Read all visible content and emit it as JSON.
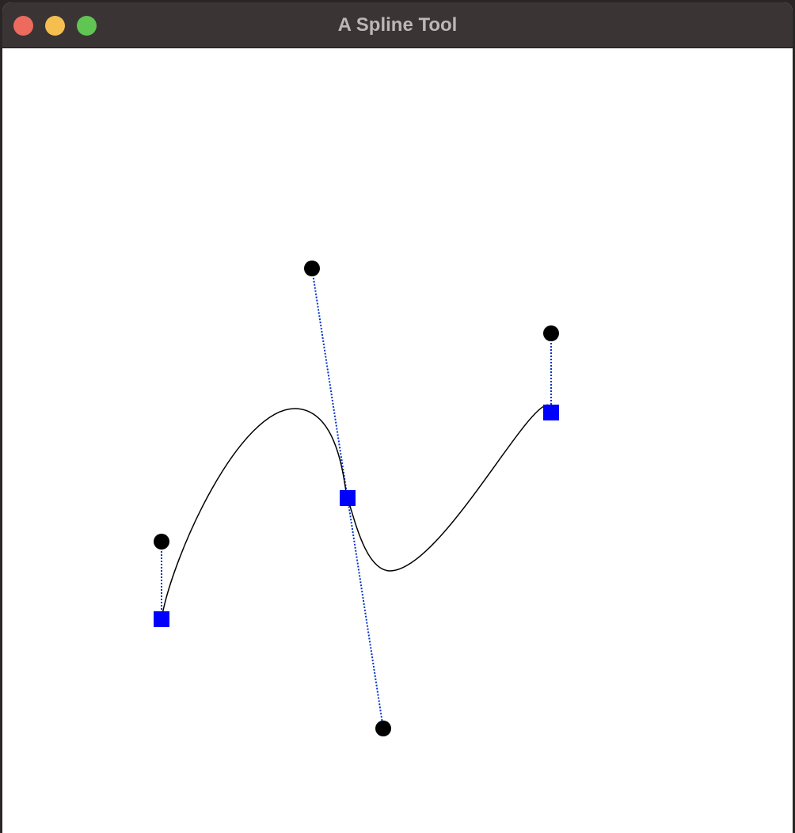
{
  "window": {
    "title": "A Spline Tool",
    "controls": [
      "close",
      "minimize",
      "maximize"
    ]
  },
  "colors": {
    "titlebar": "#3b3434",
    "title_text": "#bdb6b6",
    "close": "#ed6a5e",
    "minimize": "#f4bf4f",
    "maximize": "#61c554",
    "canvas": "#ffffff",
    "curve": "#000000",
    "anchor": "#0000ff",
    "handle": "#000000",
    "handle_line": "#0033cc"
  },
  "spline": {
    "anchor_count": 3,
    "handle_count": 4,
    "anchor_icon": "blue-square",
    "handle_icon": "black-circle"
  }
}
